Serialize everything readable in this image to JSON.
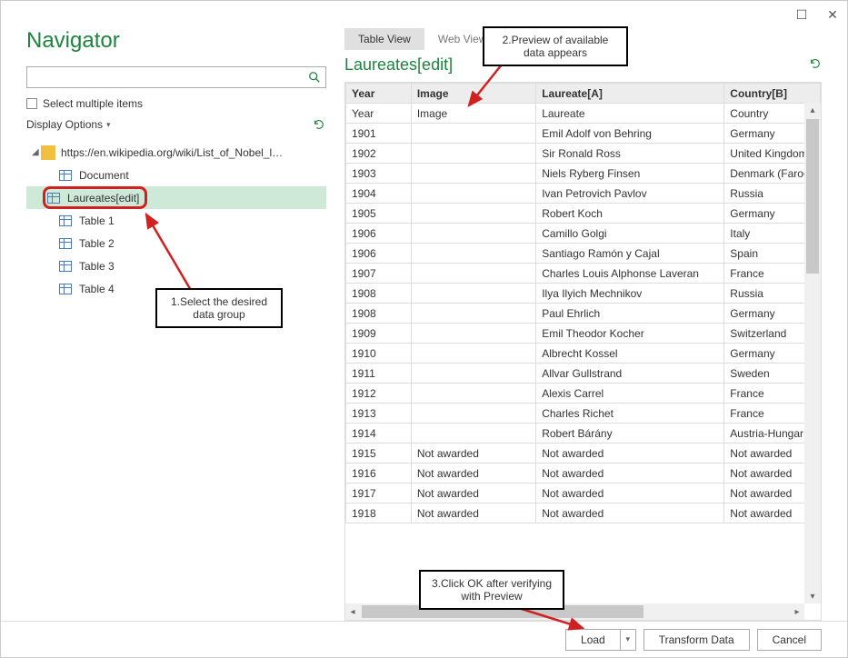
{
  "window": {
    "title": "Navigator"
  },
  "left": {
    "search_placeholder": "",
    "select_multiple": "Select multiple items",
    "display_options": "Display Options",
    "tree_root": "https://en.wikipedia.org/wiki/List_of_Nobel_lau...",
    "items": [
      {
        "label": "Document"
      },
      {
        "label": "Laureates[edit]"
      },
      {
        "label": "Table 1"
      },
      {
        "label": "Table 2"
      },
      {
        "label": "Table 3"
      },
      {
        "label": "Table 4"
      }
    ]
  },
  "tabs": {
    "table": "Table View",
    "web": "Web View"
  },
  "preview": {
    "title": "Laureates[edit]",
    "columns": [
      "Year",
      "Image",
      "Laureate[A]",
      "Country[B]"
    ],
    "rows": [
      [
        "Year",
        "Image",
        "Laureate",
        "Country"
      ],
      [
        "1901",
        "",
        "Emil Adolf von Behring",
        "Germany"
      ],
      [
        "1902",
        "",
        "Sir Ronald Ross",
        "United Kingdom"
      ],
      [
        "1903",
        "",
        "Niels Ryberg Finsen",
        "Denmark (Faroe"
      ],
      [
        "1904",
        "",
        "Ivan Petrovich Pavlov",
        "Russia"
      ],
      [
        "1905",
        "",
        "Robert Koch",
        "Germany"
      ],
      [
        "1906",
        "",
        "Camillo Golgi",
        "Italy"
      ],
      [
        "1906",
        "",
        "Santiago Ramón y Cajal",
        "Spain"
      ],
      [
        "1907",
        "",
        "Charles Louis Alphonse Laveran",
        "France"
      ],
      [
        "1908",
        "",
        "Ilya Ilyich Mechnikov",
        "Russia"
      ],
      [
        "1908",
        "",
        "Paul Ehrlich",
        "Germany"
      ],
      [
        "1909",
        "",
        "Emil Theodor Kocher",
        "Switzerland"
      ],
      [
        "1910",
        "",
        "Albrecht Kossel",
        "Germany"
      ],
      [
        "1911",
        "",
        "Allvar Gullstrand",
        "Sweden"
      ],
      [
        "1912",
        "",
        "Alexis Carrel",
        "France"
      ],
      [
        "1913",
        "",
        "Charles Richet",
        "France"
      ],
      [
        "1914",
        "",
        "Robert Bárány",
        "Austria-Hungar"
      ],
      [
        "1915",
        "Not awarded",
        "Not awarded",
        "Not awarded"
      ],
      [
        "1916",
        "Not awarded",
        "Not awarded",
        "Not awarded"
      ],
      [
        "1917",
        "Not awarded",
        "Not awarded",
        "Not awarded"
      ],
      [
        "1918",
        "Not awarded",
        "Not awarded",
        "Not awarded"
      ]
    ]
  },
  "footer": {
    "load": "Load",
    "transform": "Transform Data",
    "cancel": "Cancel"
  },
  "annotations": {
    "a1": "1.Select the desired data group",
    "a2": "2.Preview of available data appears",
    "a3": "3.Click OK after verifying with Preview"
  }
}
